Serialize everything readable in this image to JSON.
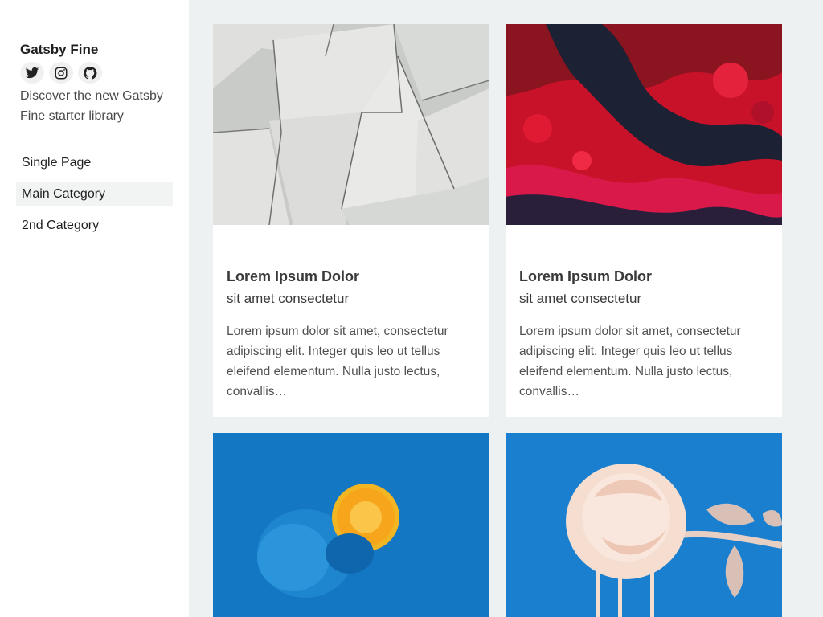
{
  "sidebar": {
    "title": "Gatsby Fine",
    "socials": [
      {
        "icon": "twitter-icon"
      },
      {
        "icon": "instagram-icon"
      },
      {
        "icon": "github-icon"
      }
    ],
    "tagline": "Discover the new Gatsby Fine starter library",
    "nav": [
      {
        "label": "Single Page",
        "active": false
      },
      {
        "label": "Main Category",
        "active": true
      },
      {
        "label": "2nd Category",
        "active": false
      }
    ]
  },
  "cards": [
    {
      "image": "white-paper-sheets-photo",
      "title": "Lorem Ipsum Dolor",
      "subtitle": "sit amet consectetur",
      "excerpt": "Lorem ipsum dolor sit amet, consectetur adipiscing elit. Integer quis leo ut tellus eleifend elementum. Nulla justo lectus, convallis…"
    },
    {
      "image": "red-fluid-paint-photo",
      "title": "Lorem Ipsum Dolor",
      "subtitle": "sit amet consectetur",
      "excerpt": "Lorem ipsum dolor sit amet, consectetur adipiscing elit. Integer quis leo ut tellus eleifend elementum. Nulla justo lectus, convallis…"
    },
    {
      "image": "blue-orange-photo"
    },
    {
      "image": "pink-rose-photo"
    }
  ],
  "colors": {
    "background": "#edf1f1",
    "sidebar": "#ffffff",
    "nav_active": "#f2f3f3",
    "photo_blue": "#1477c4"
  }
}
